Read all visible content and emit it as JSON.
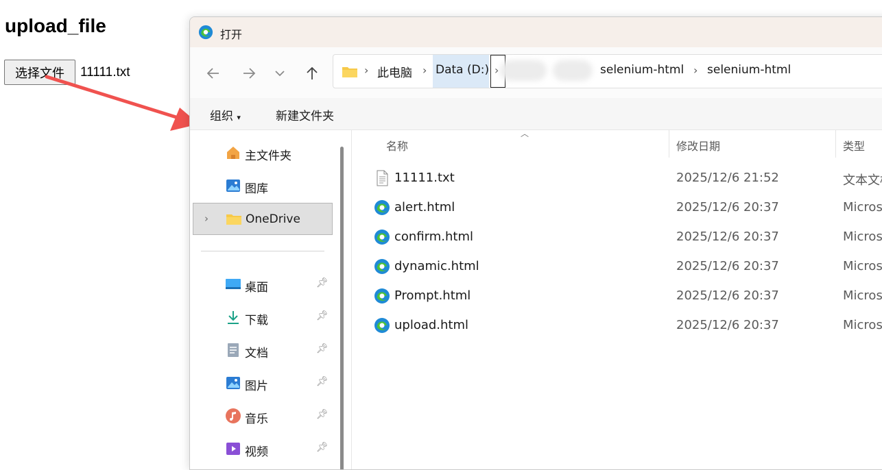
{
  "page": {
    "title": "upload_file",
    "file_button_label": "选择文件",
    "selected_file": "11111.txt"
  },
  "dialog": {
    "title": "打开",
    "address": {
      "crumbs": [
        "此电脑",
        "Data (D:)",
        "selenium-html",
        "selenium-html"
      ]
    },
    "toolbar": {
      "organize": "组织",
      "new_folder": "新建文件夹"
    },
    "nav": {
      "items": [
        {
          "label": "主文件夹",
          "icon": "home-icon"
        },
        {
          "label": "图库",
          "icon": "gallery-icon"
        },
        {
          "label": "OneDrive",
          "icon": "folder-icon",
          "selected": true
        }
      ],
      "quick_access": [
        {
          "label": "桌面",
          "icon": "desktop-icon"
        },
        {
          "label": "下载",
          "icon": "download-icon"
        },
        {
          "label": "文档",
          "icon": "document-icon"
        },
        {
          "label": "图片",
          "icon": "pictures-icon"
        },
        {
          "label": "音乐",
          "icon": "music-icon"
        },
        {
          "label": "视频",
          "icon": "video-icon"
        }
      ]
    },
    "columns": {
      "name": "名称",
      "modified": "修改日期",
      "type": "类型"
    },
    "files": [
      {
        "name": "11111.txt",
        "modified": "2025/12/6 21:52",
        "type": "文本文档",
        "icon": "text-file-icon"
      },
      {
        "name": "alert.html",
        "modified": "2025/12/6 20:37",
        "type": "Microsoft Edge HTML Document",
        "icon": "edge-icon"
      },
      {
        "name": "confirm.html",
        "modified": "2025/12/6 20:37",
        "type": "Microsoft Edge HTML Document",
        "icon": "edge-icon"
      },
      {
        "name": "dynamic.html",
        "modified": "2025/12/6 20:37",
        "type": "Microsoft Edge HTML Document",
        "icon": "edge-icon"
      },
      {
        "name": "Prompt.html",
        "modified": "2025/12/6 20:37",
        "type": "Microsoft Edge HTML Document",
        "icon": "edge-icon"
      },
      {
        "name": "upload.html",
        "modified": "2025/12/6 20:37",
        "type": "Microsoft Edge HTML Document",
        "icon": "edge-icon"
      }
    ]
  },
  "colors": {
    "accent_selection": "#dbe9f7",
    "titlebar_bg": "#f6efea",
    "arrow": "#f0524f",
    "edge_blue": "#1f8ad6",
    "edge_green": "#4cc13a"
  }
}
